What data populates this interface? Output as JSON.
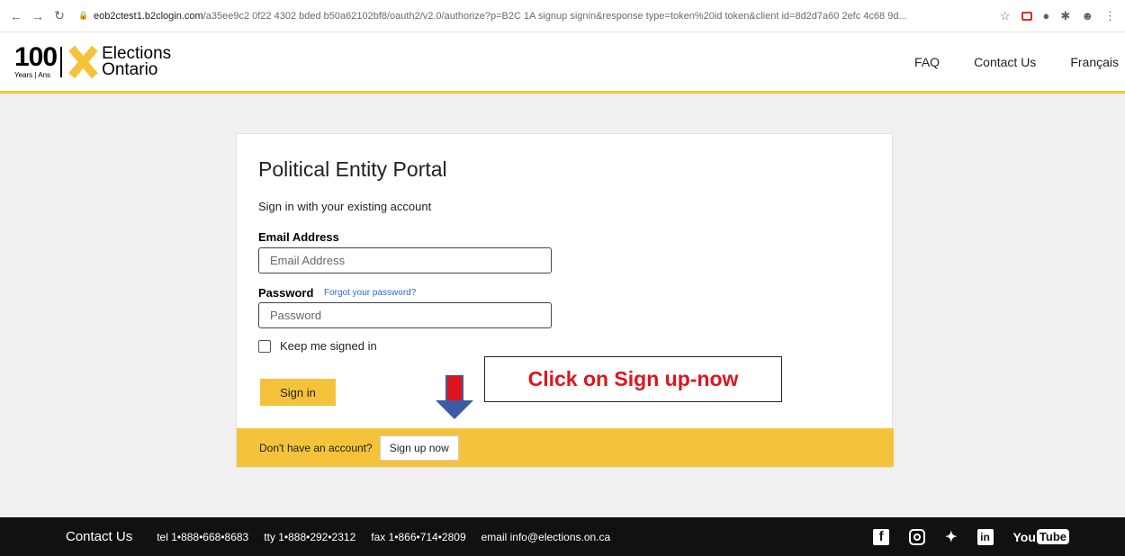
{
  "browser": {
    "back_icon": "arrow-left-icon",
    "url_host": "eob2ctest1.b2clogin.com",
    "url_path": "/a35ee9c2 0f22 4302 bded b50a62102bf8/oauth2/v2.0/authorize?p=B2C 1A signup signin&response type=token%20id token&client id=8d2d7a60 2efc 4c68 9d..."
  },
  "header": {
    "logo_100": "100",
    "logo_100_sub": "Years | Ans",
    "logo_line1": "Elections",
    "logo_line2": "Ontario",
    "nav": [
      "FAQ",
      "Contact Us",
      "Français"
    ]
  },
  "card": {
    "title": "Political Entity Portal",
    "subtitle": "Sign in with your existing account",
    "email_label": "Email Address",
    "email_placeholder": "Email Address",
    "password_label": "Password",
    "forgot_link": "Forgot your password?",
    "password_placeholder": "Password",
    "keep_signed_in": "Keep me signed in",
    "signin_button": "Sign in",
    "footer_prompt": "Don't have an account?",
    "signup_button": "Sign up now"
  },
  "annotation": {
    "callout_text": "Click on Sign up-now",
    "callout_color": "#e0141e"
  },
  "footer": {
    "contact_title": "Contact Us",
    "items": [
      "tel 1•888•668•8683",
      "tty 1•888•292•2312",
      "fax 1•866•714•2809",
      "email info@elections.on.ca"
    ],
    "social": {
      "youtube_you": "You",
      "youtube_tube": "Tube"
    }
  },
  "colors": {
    "brand_yellow": "#f5c33b",
    "footer_bg": "#111111",
    "link_blue": "#2a6ad0"
  }
}
